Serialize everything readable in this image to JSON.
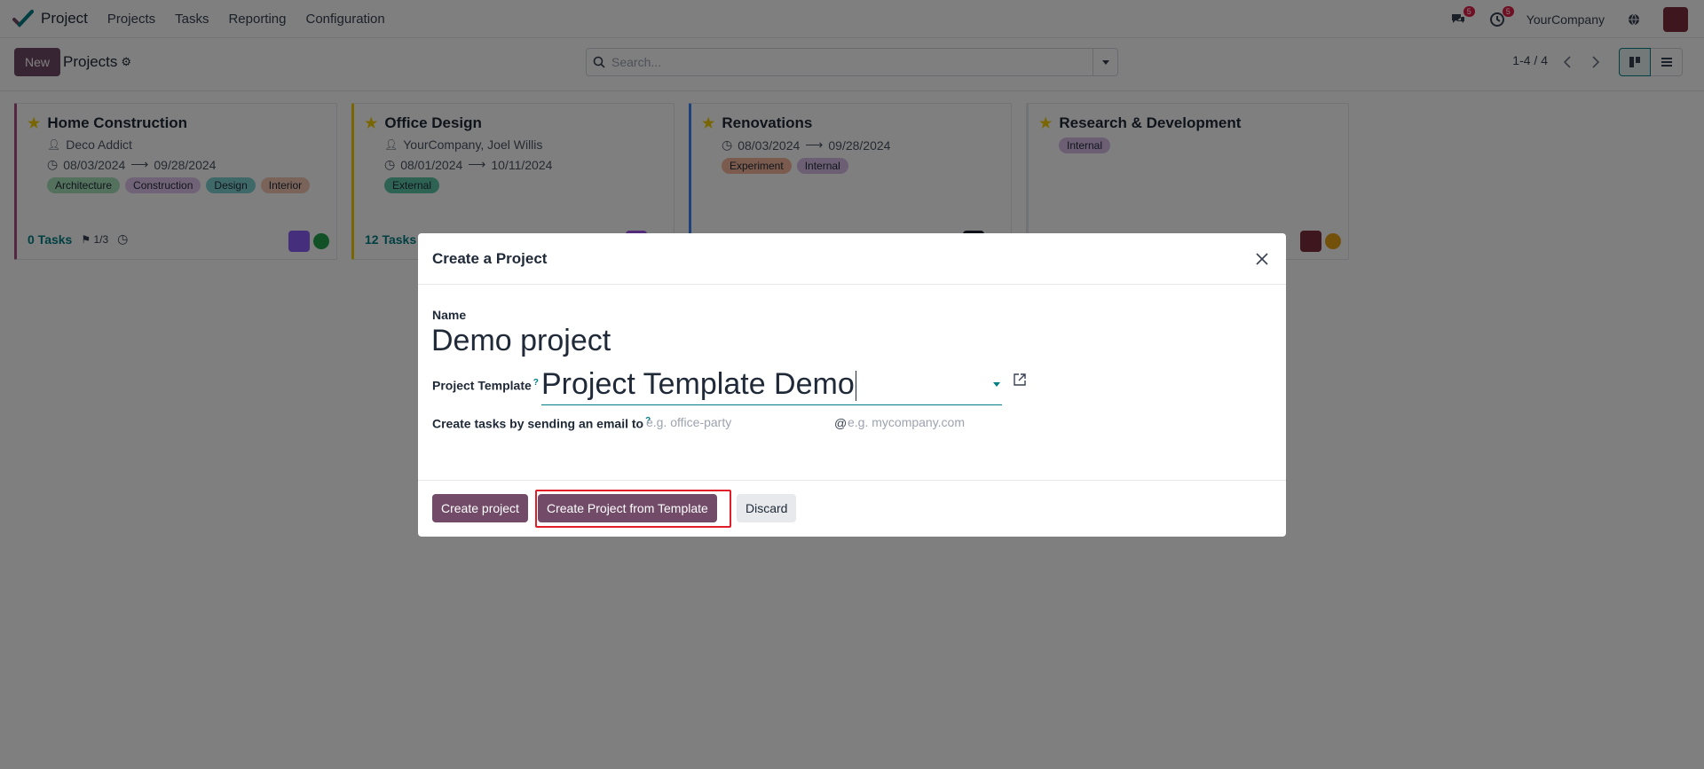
{
  "navbar": {
    "app_name": "Project",
    "menu": [
      "Projects",
      "Tasks",
      "Reporting",
      "Configuration"
    ],
    "messages_count": "5",
    "activities_count": "5",
    "company": "YourCompany"
  },
  "control_panel": {
    "new_label": "New",
    "breadcrumb": "Projects",
    "search_placeholder": "Search...",
    "pager": "1-4 / 4"
  },
  "projects": [
    {
      "title": "Home Construction",
      "customer": "Deco Addict",
      "date_start": "08/03/2024",
      "date_end": "09/28/2024",
      "tags": [
        "Architecture",
        "Construction",
        "Design",
        "Interior"
      ],
      "tasks": "0 Tasks",
      "milestones": "1/3",
      "accent": "#a94d85",
      "status_color": "#22a34a"
    },
    {
      "title": "Office Design",
      "customer": "YourCompany, Joel Willis",
      "date_start": "08/01/2024",
      "date_end": "10/11/2024",
      "tags": [
        "External"
      ],
      "tasks": "12 Tasks",
      "accent": "#f3cc00",
      "status_color": "#e8a317"
    },
    {
      "title": "Renovations",
      "date_start": "08/03/2024",
      "date_end": "09/28/2024",
      "tags": [
        "Experiment",
        "Internal"
      ],
      "accent": "#3b82f6",
      "status_color": "#22a34a"
    },
    {
      "title": "Research & Development",
      "tags": [
        "Internal"
      ],
      "accent": "#e5e7eb",
      "status_color": "#e8a317"
    }
  ],
  "tag_colors": {
    "Architecture": "#a6e3b8",
    "Construction": "#e2c6ef",
    "Design": "#7ed3d3",
    "Interior": "#f4c7b3",
    "External": "#5cc7a8",
    "Experiment": "#f4b69a",
    "Internal": "#d8bfe8"
  },
  "dialog": {
    "title": "Create a Project",
    "name_label": "Name",
    "name_value": "Demo project",
    "template_label": "Project Template",
    "template_help": "?",
    "template_value": "Project Template Demo",
    "email_label": "Create tasks by sending an email to",
    "email_help": "?",
    "alias_placeholder": "e.g. office-party",
    "at": "@",
    "domain_placeholder": "e.g. mycompany.com",
    "create_label": "Create project",
    "create_template_label": "Create Project from Template",
    "discard_label": "Discard"
  }
}
